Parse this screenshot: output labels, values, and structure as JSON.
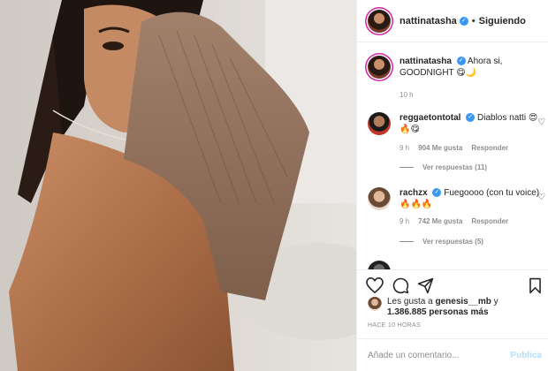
{
  "post": {
    "photo_desc_icon": "photo",
    "author": "nattinatasha",
    "follow_separator": "•",
    "follow_state": "Siguiendo"
  },
  "caption": {
    "user": "nattinatasha",
    "text": "Ahora si, GOODNIGHT 😋🌙",
    "time": "10 h"
  },
  "comments": [
    {
      "user": "reggaetontotal",
      "text": "Diablos natti 😍🔥😋",
      "time": "9 h",
      "likes": "904 Me gusta",
      "reply": "Responder",
      "replies": "Ver respuestas (11)"
    },
    {
      "user": "rachzx",
      "text": "Fuegoooo (con tu voice) 🔥🔥🔥",
      "time": "9 h",
      "likes": "742 Me gusta",
      "reply": "Responder",
      "replies": "Ver respuestas (5)"
    }
  ],
  "likes": {
    "line1": "Les gusta a ",
    "user": "genesis__mb",
    "and": " y",
    "count": "1.386.885 personas más"
  },
  "timestamp": "HACE 10 HORAS",
  "add_comment": {
    "placeholder": "Añade un comentario...",
    "publish": "Publica"
  },
  "colors": {
    "verified": "#3897f0",
    "publish_disabled": "#b2dffc",
    "meta_gray": "#8e8e8e"
  }
}
